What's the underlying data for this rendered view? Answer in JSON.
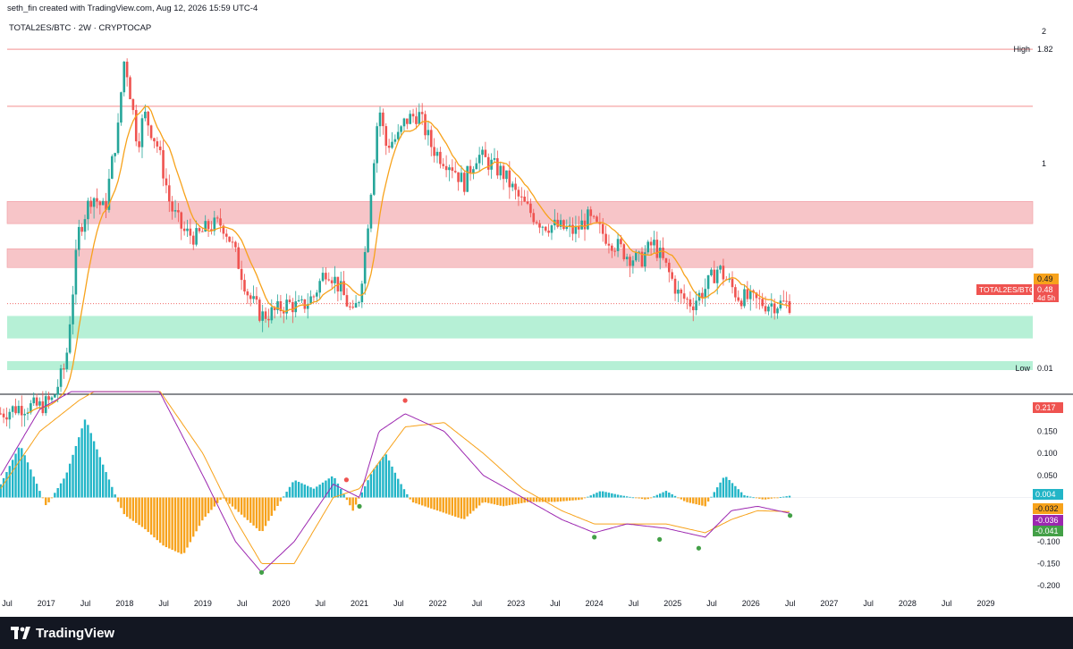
{
  "header": {
    "attribution": "seth_fin created with TradingView.com, Aug 12, 2026 15:59 UTC-4",
    "symbol_line": "TOTAL2ES/BTC · 2W · CRYPTOCAP"
  },
  "footer": {
    "brand": "TradingView"
  },
  "colors": {
    "up": "#26a69a",
    "down": "#ef5350",
    "ma": "#f7a21b",
    "resistance_line": "#f5a6a6",
    "resistance_zone": "#f7c5c8",
    "support_zone": "#b6f0d6",
    "macd_line": "#9c27b0",
    "signal_line": "#f7a21b",
    "hist_pos": "#22b5c7",
    "hist_neg": "#f7a21b"
  },
  "chart_data": [
    {
      "type": "candlestick",
      "title": "TOTAL2ES/BTC · 2W · CRYPTOCAP",
      "scale": "log",
      "ylim": [
        0.3,
        2
      ],
      "x_ticks": [
        "Jul",
        "2017",
        "Jul",
        "2018",
        "Jul",
        "2019",
        "Jul",
        "2020",
        "Jul",
        "2021",
        "Jul",
        "2022",
        "Jul",
        "2023",
        "Jul",
        "2024",
        "Jul",
        "2025",
        "Jul",
        "2026",
        "Jul",
        "2027",
        "Jul",
        "2028",
        "Jul",
        "2029"
      ],
      "y_ticks": [
        "2",
        "1"
      ],
      "price_labels": [
        {
          "text": "High",
          "value": "1.82",
          "color": "#ffffff",
          "bg": "#ffffff"
        },
        {
          "text": "",
          "value": "0.49",
          "color": "#131722",
          "bg": "#f7a21b"
        },
        {
          "text": "TOTAL2ES/BTC",
          "value": "0.48",
          "sub": "4d 5h",
          "color": "#ffffff",
          "bg": "#ef5350"
        },
        {
          "text": "Low",
          "value": "0.01",
          "color": "#ffffff",
          "bg": "#ffffff"
        }
      ],
      "levels": [
        {
          "kind": "line",
          "value": 1.82,
          "label": "High"
        },
        {
          "kind": "line",
          "value": 1.35
        },
        {
          "kind": "zone",
          "from": 0.73,
          "to": 0.82
        },
        {
          "kind": "zone",
          "from": 0.58,
          "to": 0.64
        },
        {
          "kind": "support",
          "from": 0.4,
          "to": 0.45
        },
        {
          "kind": "support",
          "from": 0.01,
          "to": 0.012,
          "label": "Low"
        }
      ],
      "close_series": [
        [
          "2016-06",
          0.27
        ],
        [
          "2016-09",
          0.28
        ],
        [
          "2016-12",
          0.28
        ],
        [
          "2017-02",
          0.29
        ],
        [
          "2017-04",
          0.35
        ],
        [
          "2017-05",
          0.5
        ],
        [
          "2017-06",
          0.7
        ],
        [
          "2017-08",
          0.85
        ],
        [
          "2017-10",
          0.78
        ],
        [
          "2017-12",
          1.2
        ],
        [
          "2018-01",
          1.75
        ],
        [
          "2018-02",
          1.4
        ],
        [
          "2018-03",
          1.1
        ],
        [
          "2018-04",
          1.3
        ],
        [
          "2018-06",
          1.1
        ],
        [
          "2018-08",
          0.8
        ],
        [
          "2018-10",
          0.7
        ],
        [
          "2018-12",
          0.68
        ],
        [
          "2019-02",
          0.72
        ],
        [
          "2019-04",
          0.73
        ],
        [
          "2019-05",
          0.68
        ],
        [
          "2019-06",
          0.62
        ],
        [
          "2019-08",
          0.5
        ],
        [
          "2019-10",
          0.45
        ],
        [
          "2019-12",
          0.46
        ],
        [
          "2020-02",
          0.48
        ],
        [
          "2020-04",
          0.47
        ],
        [
          "2020-06",
          0.5
        ],
        [
          "2020-08",
          0.58
        ],
        [
          "2020-10",
          0.52
        ],
        [
          "2020-12",
          0.45
        ],
        [
          "2021-01",
          0.5
        ],
        [
          "2021-02",
          0.65
        ],
        [
          "2021-03",
          0.95
        ],
        [
          "2021-04",
          1.35
        ],
        [
          "2021-05",
          1.1
        ],
        [
          "2021-07",
          1.15
        ],
        [
          "2021-08",
          1.25
        ],
        [
          "2021-10",
          1.3
        ],
        [
          "2021-12",
          1.1
        ],
        [
          "2022-01",
          1.05
        ],
        [
          "2022-03",
          1.0
        ],
        [
          "2022-05",
          0.9
        ],
        [
          "2022-07",
          1.05
        ],
        [
          "2022-09",
          1.0
        ],
        [
          "2022-11",
          0.95
        ],
        [
          "2023-01",
          0.85
        ],
        [
          "2023-03",
          0.78
        ],
        [
          "2023-05",
          0.73
        ],
        [
          "2023-07",
          0.72
        ],
        [
          "2023-10",
          0.7
        ],
        [
          "2023-12",
          0.75
        ],
        [
          "2024-02",
          0.7
        ],
        [
          "2024-04",
          0.66
        ],
        [
          "2024-06",
          0.62
        ],
        [
          "2024-08",
          0.6
        ],
        [
          "2024-10",
          0.66
        ],
        [
          "2024-12",
          0.58
        ],
        [
          "2025-02",
          0.5
        ],
        [
          "2025-04",
          0.48
        ],
        [
          "2025-06",
          0.52
        ],
        [
          "2025-08",
          0.58
        ],
        [
          "2025-09",
          0.55
        ],
        [
          "2025-11",
          0.5
        ],
        [
          "2026-01",
          0.49
        ],
        [
          "2026-03",
          0.48
        ],
        [
          "2026-05",
          0.48
        ],
        [
          "2026-07",
          0.48
        ]
      ]
    },
    {
      "type": "macd",
      "ylim": [
        -0.22,
        0.22
      ],
      "y_ticks": [
        "0.200",
        "0.150",
        "0.100",
        "0.050",
        "-0.100",
        "-0.150",
        "-0.200"
      ],
      "value_labels": [
        {
          "value": "0.217",
          "bg": "#ef5350",
          "color": "#ffffff"
        },
        {
          "value": "0.004",
          "bg": "#22b5c7",
          "color": "#ffffff"
        },
        {
          "value": "-0.032",
          "bg": "#f7a21b",
          "color": "#131722"
        },
        {
          "value": "-0.036",
          "bg": "#9c27b0",
          "color": "#ffffff"
        },
        {
          "value": "-0.041",
          "bg": "#43a047",
          "color": "#ffffff"
        }
      ],
      "histogram_envelope": [
        [
          "2016-06",
          0.03
        ],
        [
          "2016-09",
          0.12
        ],
        [
          "2016-11",
          0.05
        ],
        [
          "2017-01",
          -0.02
        ],
        [
          "2017-04",
          0.05
        ],
        [
          "2017-07",
          0.18
        ],
        [
          "2017-09",
          0.1
        ],
        [
          "2017-12",
          -0.01
        ],
        [
          "2018-01",
          -0.04
        ],
        [
          "2018-04",
          -0.07
        ],
        [
          "2018-07",
          -0.11
        ],
        [
          "2018-10",
          -0.13
        ],
        [
          "2019-01",
          -0.05
        ],
        [
          "2019-04",
          0.0
        ],
        [
          "2019-07",
          -0.04
        ],
        [
          "2019-10",
          -0.08
        ],
        [
          "2019-12",
          -0.03
        ],
        [
          "2020-03",
          0.04
        ],
        [
          "2020-06",
          0.02
        ],
        [
          "2020-09",
          0.05
        ],
        [
          "2020-12",
          -0.03
        ],
        [
          "2021-01",
          0.0
        ],
        [
          "2021-03",
          0.06
        ],
        [
          "2021-05",
          0.1
        ],
        [
          "2021-07",
          0.04
        ],
        [
          "2021-09",
          -0.01
        ],
        [
          "2022-01",
          -0.03
        ],
        [
          "2022-05",
          -0.05
        ],
        [
          "2022-08",
          -0.01
        ],
        [
          "2022-11",
          -0.02
        ],
        [
          "2023-03",
          -0.01
        ],
        [
          "2023-07",
          -0.01
        ],
        [
          "2023-11",
          -0.005
        ],
        [
          "2024-02",
          0.015
        ],
        [
          "2024-05",
          0.005
        ],
        [
          "2024-09",
          -0.005
        ],
        [
          "2024-12",
          0.015
        ],
        [
          "2025-03",
          -0.01
        ],
        [
          "2025-06",
          -0.02
        ],
        [
          "2025-09",
          0.05
        ],
        [
          "2025-12",
          0.005
        ],
        [
          "2026-03",
          -0.005
        ],
        [
          "2026-07",
          0.004
        ]
      ],
      "macd_series": [
        [
          "2016-06",
          0.05
        ],
        [
          "2016-12",
          0.2
        ],
        [
          "2017-06",
          0.25
        ],
        [
          "2018-01",
          0.3
        ],
        [
          "2018-06",
          0.25
        ],
        [
          "2019-01",
          0.05
        ],
        [
          "2019-06",
          -0.1
        ],
        [
          "2019-10",
          -0.17
        ],
        [
          "2020-03",
          -0.1
        ],
        [
          "2020-09",
          0.03
        ],
        [
          "2021-01",
          0.0
        ],
        [
          "2021-04",
          0.15
        ],
        [
          "2021-08",
          0.19
        ],
        [
          "2022-02",
          0.15
        ],
        [
          "2022-08",
          0.05
        ],
        [
          "2023-02",
          0.0
        ],
        [
          "2023-08",
          -0.05
        ],
        [
          "2024-01",
          -0.08
        ],
        [
          "2024-06",
          -0.06
        ],
        [
          "2024-12",
          -0.07
        ],
        [
          "2025-06",
          -0.09
        ],
        [
          "2025-10",
          -0.03
        ],
        [
          "2026-02",
          -0.02
        ],
        [
          "2026-07",
          -0.036
        ]
      ],
      "signal_series": [
        [
          "2016-06",
          0.02
        ],
        [
          "2016-12",
          0.15
        ],
        [
          "2017-06",
          0.22
        ],
        [
          "2018-01",
          0.28
        ],
        [
          "2018-06",
          0.25
        ],
        [
          "2019-01",
          0.1
        ],
        [
          "2019-06",
          -0.05
        ],
        [
          "2019-10",
          -0.15
        ],
        [
          "2020-03",
          -0.15
        ],
        [
          "2020-09",
          0.0
        ],
        [
          "2021-01",
          0.02
        ],
        [
          "2021-04",
          0.08
        ],
        [
          "2021-08",
          0.16
        ],
        [
          "2022-02",
          0.17
        ],
        [
          "2022-08",
          0.1
        ],
        [
          "2023-02",
          0.02
        ],
        [
          "2023-08",
          -0.03
        ],
        [
          "2024-01",
          -0.06
        ],
        [
          "2024-06",
          -0.06
        ],
        [
          "2024-12",
          -0.06
        ],
        [
          "2025-06",
          -0.08
        ],
        [
          "2025-10",
          -0.05
        ],
        [
          "2026-02",
          -0.03
        ],
        [
          "2026-07",
          -0.032
        ]
      ],
      "cross_markers": [
        {
          "x": "2019-10",
          "value": -0.17,
          "color": "#43a047"
        },
        {
          "x": "2020-11",
          "value": 0.04,
          "color": "#ef5350"
        },
        {
          "x": "2021-01",
          "value": -0.02,
          "color": "#43a047"
        },
        {
          "x": "2021-08",
          "value": 0.22,
          "color": "#ef5350"
        },
        {
          "x": "2024-01",
          "value": -0.09,
          "color": "#43a047"
        },
        {
          "x": "2024-11",
          "value": -0.095,
          "color": "#43a047"
        },
        {
          "x": "2025-05",
          "value": -0.115,
          "color": "#43a047"
        },
        {
          "x": "2026-07",
          "value": -0.041,
          "color": "#43a047"
        }
      ]
    }
  ]
}
